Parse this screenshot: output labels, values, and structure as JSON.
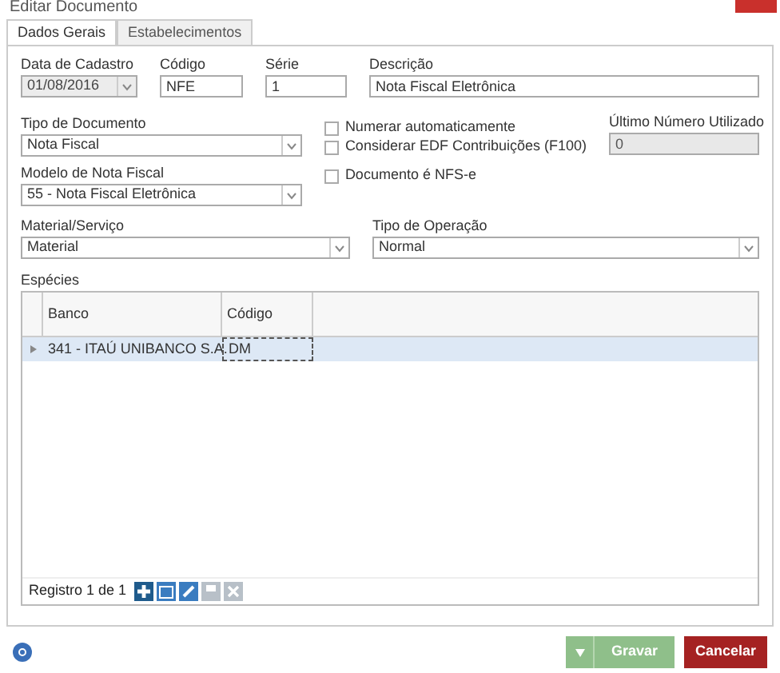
{
  "window": {
    "title": "Editar Documento"
  },
  "tabs": [
    {
      "label": "Dados Gerais",
      "selected": true
    },
    {
      "label": "Estabelecimentos",
      "selected": false
    }
  ],
  "row1": [
    {
      "kind": "date",
      "label": "Data de Cadastro",
      "value": "01/08/2016",
      "disabled": true
    },
    {
      "kind": "text",
      "label": "Código",
      "value": "NFE"
    },
    {
      "kind": "text",
      "label": "Série",
      "value": "1"
    },
    {
      "kind": "text",
      "label": "Descrição",
      "value": "Nota Fiscal Eletrônica"
    }
  ],
  "tipo_documento": {
    "label": "Tipo de Documento",
    "value": "Nota Fiscal"
  },
  "modelo": {
    "label": "Modelo de Nota Fiscal",
    "value": "55 - Nota Fiscal Eletrônica"
  },
  "checkboxes": [
    {
      "label": "Numerar automaticamente",
      "checked": false
    },
    {
      "label": "Considerar EDF Contribuições (F100)",
      "checked": false
    },
    {
      "label": "Documento é NFS-e",
      "checked": false
    }
  ],
  "ultimo_numero": {
    "label": "Último Número Utilizado",
    "value": "0",
    "disabled": true
  },
  "material": {
    "label": "Material/Serviço",
    "value": "Material"
  },
  "operacao": {
    "label": "Tipo de Operação",
    "value": "Normal"
  },
  "especies": {
    "label": "Espécies",
    "columns": [
      "Banco",
      "Código"
    ],
    "rows": [
      {
        "cells": [
          "341 - ITAÚ UNIBANCO S.A.",
          "DM"
        ],
        "selected": true
      }
    ],
    "pager": "Registro 1 de 1"
  },
  "buttons": [
    {
      "kind": "save",
      "label": "Gravar",
      "disabled": true
    },
    {
      "kind": "cancel",
      "label": "Cancelar",
      "disabled": false
    }
  ]
}
